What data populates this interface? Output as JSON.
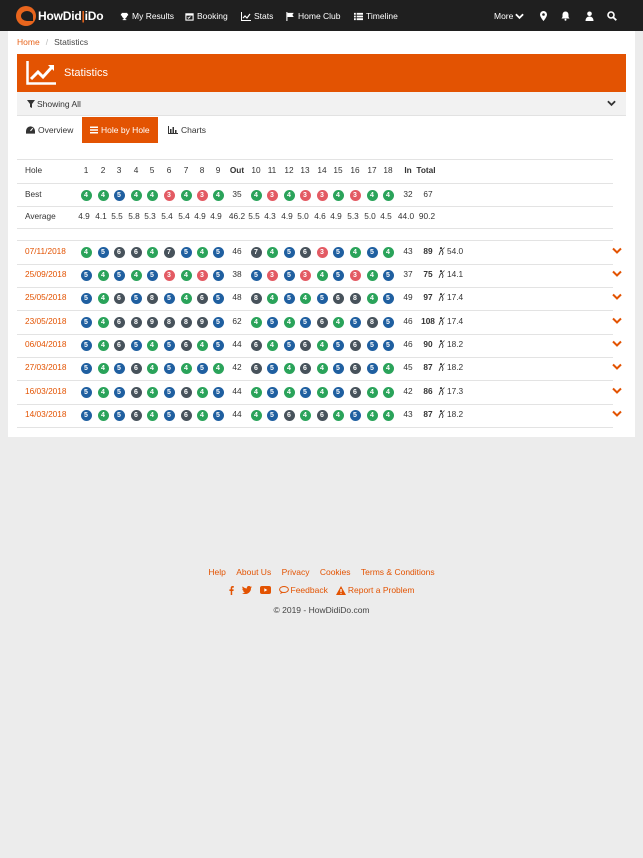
{
  "nav": {
    "brand_left": "HowDid",
    "brand_right": "iDo",
    "items": [
      {
        "label": "My Results",
        "icon": "trophy-icon"
      },
      {
        "label": "Booking",
        "icon": "calendar-icon"
      },
      {
        "label": "Stats",
        "icon": "line-chart-icon"
      },
      {
        "label": "Home Club",
        "icon": "flag-icon"
      },
      {
        "label": "Timeline",
        "icon": "list-icon"
      }
    ],
    "more_label": "More",
    "right_icons": [
      "map-marker-icon",
      "bell-icon",
      "user-icon",
      "search-icon"
    ]
  },
  "breadcrumb": {
    "home": "Home",
    "separator": "/",
    "current": "Statistics"
  },
  "header": {
    "title": "Statistics",
    "icon": "line-chart-icon"
  },
  "filter": {
    "label": "Showing All",
    "icon": "filter-icon",
    "toggle_icon": "chevron-down-icon"
  },
  "tabs": [
    {
      "label": "Overview",
      "icon": "dashboard-icon",
      "active": false
    },
    {
      "label": "Hole by Hole",
      "icon": "list-icon",
      "active": true
    },
    {
      "label": "Charts",
      "icon": "bar-chart-icon",
      "active": false
    }
  ],
  "colors": {
    "accent": "#e35302",
    "birdie_or_better": "#1f5fa0",
    "par": "#2aa35a",
    "bogey": "#47525b",
    "double_bogey_plus": "#e35a63"
  },
  "table": {
    "hole_label": "Hole",
    "front_holes": [
      "1",
      "2",
      "3",
      "4",
      "5",
      "6",
      "7",
      "8",
      "9"
    ],
    "out_label": "Out",
    "back_holes": [
      "10",
      "11",
      "12",
      "13",
      "14",
      "15",
      "16",
      "17",
      "18"
    ],
    "in_label": "In",
    "total_label": "Total",
    "best": {
      "label": "Best",
      "front": [
        [
          "4",
          "par"
        ],
        [
          "4",
          "par"
        ],
        [
          "5",
          "birdie"
        ],
        [
          "4",
          "par"
        ],
        [
          "4",
          "par"
        ],
        [
          "3",
          "double"
        ],
        [
          "4",
          "par"
        ],
        [
          "3",
          "double"
        ],
        [
          "4",
          "par"
        ]
      ],
      "out": "35",
      "back": [
        [
          "4",
          "par"
        ],
        [
          "3",
          "double"
        ],
        [
          "4",
          "par"
        ],
        [
          "3",
          "double"
        ],
        [
          "3",
          "double"
        ],
        [
          "4",
          "par"
        ],
        [
          "3",
          "double"
        ],
        [
          "4",
          "par"
        ],
        [
          "4",
          "par"
        ]
      ],
      "in": "32",
      "total": "67"
    },
    "average": {
      "label": "Average",
      "front": [
        "4.9",
        "4.1",
        "5.5",
        "5.8",
        "5.3",
        "5.4",
        "5.4",
        "4.9",
        "4.9"
      ],
      "out": "46.2",
      "back": [
        "5.5",
        "4.3",
        "4.9",
        "5.0",
        "4.6",
        "4.9",
        "5.3",
        "5.0",
        "4.5"
      ],
      "in": "44.0",
      "total": "90.2"
    },
    "rounds": [
      {
        "date": "07/11/2018",
        "front": [
          [
            "4",
            "par"
          ],
          [
            "5",
            "birdie"
          ],
          [
            "6",
            "bogey"
          ],
          [
            "6",
            "bogey"
          ],
          [
            "4",
            "par"
          ],
          [
            "7",
            "bogey"
          ],
          [
            "5",
            "birdie"
          ],
          [
            "4",
            "par"
          ],
          [
            "5",
            "birdie"
          ]
        ],
        "out": "46",
        "back": [
          [
            "7",
            "bogey"
          ],
          [
            "4",
            "par"
          ],
          [
            "5",
            "birdie"
          ],
          [
            "6",
            "bogey"
          ],
          [
            "3",
            "double"
          ],
          [
            "5",
            "birdie"
          ],
          [
            "4",
            "par"
          ],
          [
            "5",
            "birdie"
          ],
          [
            "4",
            "par"
          ]
        ],
        "in": "43",
        "total": "89",
        "handicap": "54.0"
      },
      {
        "date": "25/09/2018",
        "front": [
          [
            "5",
            "birdie"
          ],
          [
            "4",
            "par"
          ],
          [
            "5",
            "birdie"
          ],
          [
            "4",
            "par"
          ],
          [
            "5",
            "birdie"
          ],
          [
            "3",
            "double"
          ],
          [
            "4",
            "par"
          ],
          [
            "3",
            "double"
          ],
          [
            "5",
            "birdie"
          ]
        ],
        "out": "38",
        "back": [
          [
            "5",
            "birdie"
          ],
          [
            "3",
            "double"
          ],
          [
            "5",
            "birdie"
          ],
          [
            "3",
            "double"
          ],
          [
            "4",
            "par"
          ],
          [
            "5",
            "birdie"
          ],
          [
            "3",
            "double"
          ],
          [
            "4",
            "par"
          ],
          [
            "5",
            "birdie"
          ]
        ],
        "in": "37",
        "total": "75",
        "handicap": "14.1"
      },
      {
        "date": "25/05/2018",
        "front": [
          [
            "5",
            "birdie"
          ],
          [
            "4",
            "par"
          ],
          [
            "6",
            "bogey"
          ],
          [
            "5",
            "birdie"
          ],
          [
            "8",
            "bogey"
          ],
          [
            "5",
            "birdie"
          ],
          [
            "4",
            "par"
          ],
          [
            "6",
            "bogey"
          ],
          [
            "5",
            "birdie"
          ]
        ],
        "out": "48",
        "back": [
          [
            "8",
            "bogey"
          ],
          [
            "4",
            "par"
          ],
          [
            "5",
            "birdie"
          ],
          [
            "4",
            "par"
          ],
          [
            "5",
            "birdie"
          ],
          [
            "6",
            "bogey"
          ],
          [
            "8",
            "bogey"
          ],
          [
            "4",
            "par"
          ],
          [
            "5",
            "birdie"
          ]
        ],
        "in": "49",
        "total": "97",
        "handicap": "17.4"
      },
      {
        "date": "23/05/2018",
        "front": [
          [
            "5",
            "birdie"
          ],
          [
            "4",
            "par"
          ],
          [
            "6",
            "bogey"
          ],
          [
            "8",
            "bogey"
          ],
          [
            "9",
            "bogey"
          ],
          [
            "8",
            "bogey"
          ],
          [
            "8",
            "bogey"
          ],
          [
            "9",
            "bogey"
          ],
          [
            "5",
            "birdie"
          ]
        ],
        "out": "62",
        "back": [
          [
            "4",
            "par"
          ],
          [
            "5",
            "birdie"
          ],
          [
            "4",
            "par"
          ],
          [
            "5",
            "birdie"
          ],
          [
            "6",
            "bogey"
          ],
          [
            "4",
            "par"
          ],
          [
            "5",
            "birdie"
          ],
          [
            "8",
            "bogey"
          ],
          [
            "5",
            "birdie"
          ]
        ],
        "in": "46",
        "total": "108",
        "handicap": "17.4"
      },
      {
        "date": "06/04/2018",
        "front": [
          [
            "5",
            "birdie"
          ],
          [
            "4",
            "par"
          ],
          [
            "6",
            "bogey"
          ],
          [
            "5",
            "birdie"
          ],
          [
            "4",
            "par"
          ],
          [
            "5",
            "birdie"
          ],
          [
            "6",
            "bogey"
          ],
          [
            "4",
            "par"
          ],
          [
            "5",
            "birdie"
          ]
        ],
        "out": "44",
        "back": [
          [
            "6",
            "bogey"
          ],
          [
            "4",
            "par"
          ],
          [
            "5",
            "birdie"
          ],
          [
            "6",
            "bogey"
          ],
          [
            "4",
            "par"
          ],
          [
            "5",
            "birdie"
          ],
          [
            "6",
            "bogey"
          ],
          [
            "5",
            "birdie"
          ],
          [
            "5",
            "birdie"
          ]
        ],
        "in": "46",
        "total": "90",
        "handicap": "18.2"
      },
      {
        "date": "27/03/2018",
        "front": [
          [
            "5",
            "birdie"
          ],
          [
            "4",
            "par"
          ],
          [
            "5",
            "birdie"
          ],
          [
            "6",
            "bogey"
          ],
          [
            "4",
            "par"
          ],
          [
            "5",
            "birdie"
          ],
          [
            "4",
            "par"
          ],
          [
            "5",
            "birdie"
          ],
          [
            "4",
            "par"
          ]
        ],
        "out": "42",
        "back": [
          [
            "6",
            "bogey"
          ],
          [
            "5",
            "birdie"
          ],
          [
            "4",
            "par"
          ],
          [
            "6",
            "bogey"
          ],
          [
            "4",
            "par"
          ],
          [
            "5",
            "birdie"
          ],
          [
            "6",
            "bogey"
          ],
          [
            "5",
            "birdie"
          ],
          [
            "4",
            "par"
          ]
        ],
        "in": "45",
        "total": "87",
        "handicap": "18.2"
      },
      {
        "date": "16/03/2018",
        "front": [
          [
            "5",
            "birdie"
          ],
          [
            "4",
            "par"
          ],
          [
            "5",
            "birdie"
          ],
          [
            "6",
            "bogey"
          ],
          [
            "4",
            "par"
          ],
          [
            "5",
            "birdie"
          ],
          [
            "6",
            "bogey"
          ],
          [
            "4",
            "par"
          ],
          [
            "5",
            "birdie"
          ]
        ],
        "out": "44",
        "back": [
          [
            "4",
            "par"
          ],
          [
            "5",
            "birdie"
          ],
          [
            "4",
            "par"
          ],
          [
            "5",
            "birdie"
          ],
          [
            "4",
            "par"
          ],
          [
            "5",
            "birdie"
          ],
          [
            "6",
            "bogey"
          ],
          [
            "4",
            "par"
          ],
          [
            "4",
            "par"
          ]
        ],
        "in": "42",
        "total": "86",
        "handicap": "17.3"
      },
      {
        "date": "14/03/2018",
        "front": [
          [
            "5",
            "birdie"
          ],
          [
            "4",
            "par"
          ],
          [
            "5",
            "birdie"
          ],
          [
            "6",
            "bogey"
          ],
          [
            "4",
            "par"
          ],
          [
            "5",
            "birdie"
          ],
          [
            "6",
            "bogey"
          ],
          [
            "4",
            "par"
          ],
          [
            "5",
            "birdie"
          ]
        ],
        "out": "44",
        "back": [
          [
            "4",
            "par"
          ],
          [
            "5",
            "birdie"
          ],
          [
            "6",
            "bogey"
          ],
          [
            "4",
            "par"
          ],
          [
            "6",
            "bogey"
          ],
          [
            "4",
            "par"
          ],
          [
            "5",
            "birdie"
          ],
          [
            "4",
            "par"
          ],
          [
            "4",
            "par"
          ]
        ],
        "in": "43",
        "total": "87",
        "handicap": "18.2"
      }
    ]
  },
  "footer": {
    "links": [
      "Help",
      "About Us",
      "Privacy",
      "Cookies",
      "Terms & Conditions"
    ],
    "social_icons": [
      "facebook-icon",
      "twitter-icon",
      "youtube-icon"
    ],
    "feedback_label": "Feedback",
    "report_label": "Report a Problem",
    "copyright": "© 2019 - HowDidiDo.com"
  }
}
